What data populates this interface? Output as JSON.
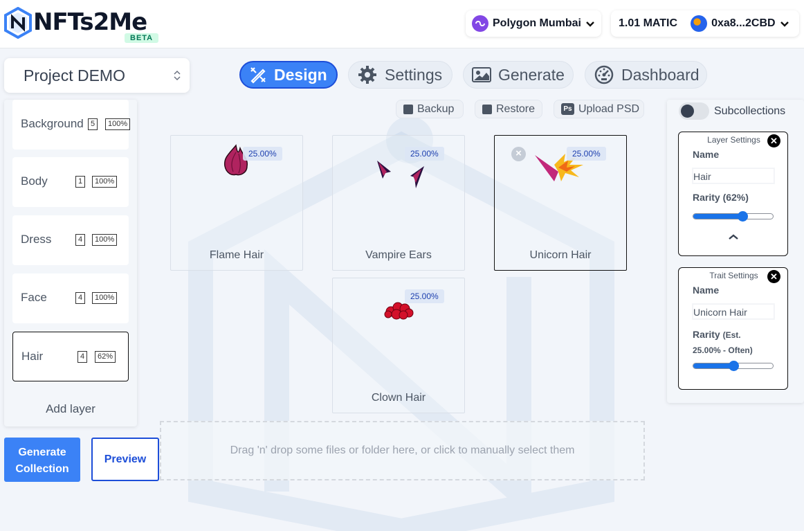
{
  "app": {
    "logo_text": "NFTs2Me",
    "beta_badge": "BETA"
  },
  "header": {
    "network_label": "Polygon Mumbai",
    "wallet_balance": "1.01 MATIC",
    "wallet_address": "0xa8...2CBD"
  },
  "project": {
    "name": "Project DEMO"
  },
  "tabs": [
    {
      "label": "Design",
      "icon": "pencil-ruler-icon",
      "active": true
    },
    {
      "label": "Settings",
      "icon": "gear-icon",
      "active": false
    },
    {
      "label": "Generate",
      "icon": "image-icon",
      "active": false
    },
    {
      "label": "Dashboard",
      "icon": "gauge-icon",
      "active": false
    }
  ],
  "layers": [
    {
      "name": "Background",
      "count": "5",
      "pct": "100%",
      "selected": false
    },
    {
      "name": "Body",
      "count": "1",
      "pct": "100%",
      "selected": false
    },
    {
      "name": "Dress",
      "count": "4",
      "pct": "100%",
      "selected": false
    },
    {
      "name": "Face",
      "count": "4",
      "pct": "100%",
      "selected": false
    },
    {
      "name": "Hair",
      "count": "4",
      "pct": "62%",
      "selected": true
    }
  ],
  "add_layer_label": "Add layer",
  "buttons": {
    "generate_collection": "Generate Collection",
    "preview": "Preview"
  },
  "actions": {
    "backup": "Backup",
    "restore": "Restore",
    "upload_psd": "Upload PSD",
    "ps_icon_text": "Ps"
  },
  "traits": [
    {
      "name": "Flame Hair",
      "pct": "25.00%",
      "selected": false
    },
    {
      "name": "Vampire Ears",
      "pct": "25.00%",
      "selected": false
    },
    {
      "name": "Unicorn Hair",
      "pct": "25.00%",
      "selected": true
    },
    {
      "name": "Clown Hair",
      "pct": "25.00%",
      "selected": false
    }
  ],
  "dropzone_text": "Drag 'n' drop some files or folder here, or click to manually select them",
  "right_panel": {
    "subcollections_label": "Subcollections",
    "subcollections_on": false,
    "layer_settings": {
      "title": "Layer Settings",
      "name_label": "Name",
      "name_value": "Hair",
      "rarity_label": "Rarity (62%)",
      "rarity_value": 0.62
    },
    "trait_settings": {
      "title": "Trait Settings",
      "name_label": "Name",
      "name_value": "Unicorn Hair",
      "rarity_label": "Rarity",
      "rarity_est_line1": "(Est.",
      "rarity_est_line2": "25.00% - Often)",
      "rarity_value": 0.5
    }
  },
  "colors": {
    "accent": "#3b82f6",
    "accent_dark": "#1d4ed8",
    "polygon": "#8247e5",
    "beta_bg": "#d1fae5",
    "beta_text": "#047857"
  }
}
